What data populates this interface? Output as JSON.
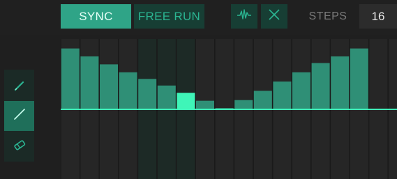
{
  "header": {
    "sync_label": "SYNC",
    "free_run_label": "FREE RUN",
    "steps_label": "STEPS",
    "steps_value": "16",
    "active_mode": "sync"
  },
  "icons": {
    "wave": "waveform-icon",
    "clear": "close-icon",
    "pencil": "pencil-icon",
    "line": "line-tool-icon",
    "eraser": "eraser-icon"
  },
  "tools": {
    "active": "line"
  },
  "colors": {
    "accent": "#2fa487",
    "bar": "#2f8f76",
    "highlight_bar": "#3ff5b8",
    "baseline": "#3ff5b8",
    "dark_accent": "#173e34",
    "background": "#1f1f1f"
  },
  "sequencer": {
    "steps": 18,
    "baseline": 0,
    "range": [
      -1,
      1
    ],
    "values": [
      0.92,
      0.8,
      0.68,
      0.56,
      0.46,
      0.36,
      0.25,
      0.13,
      0.02,
      0.14,
      0.28,
      0.42,
      0.56,
      0.7,
      0.8,
      0.92,
      null,
      null
    ],
    "highlight_index": 6,
    "shaded_columns": [
      4,
      5,
      6
    ]
  }
}
